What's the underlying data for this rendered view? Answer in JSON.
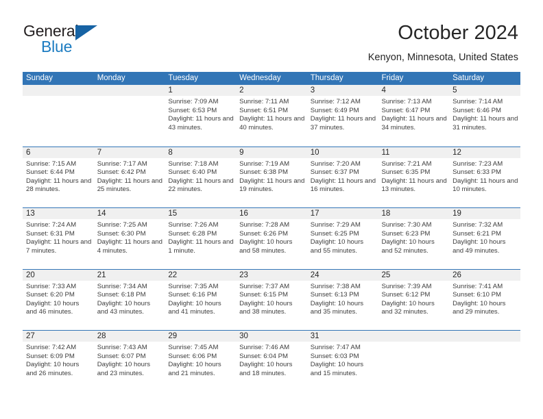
{
  "brand": {
    "word1": "General",
    "word2": "Blue",
    "triangle_color": "#1763a4",
    "word2_color": "#1c7cc1"
  },
  "header": {
    "title": "October 2024",
    "location": "Kenyon, Minnesota, United States"
  },
  "theme": {
    "header_blue": "#3275b6",
    "daynum_band": "#f0f0f0",
    "text": "#262626"
  },
  "weekdays": [
    "Sunday",
    "Monday",
    "Tuesday",
    "Wednesday",
    "Thursday",
    "Friday",
    "Saturday"
  ],
  "weeks": [
    [
      {
        "day": "",
        "sunrise": "",
        "sunset": "",
        "daylight": ""
      },
      {
        "day": "",
        "sunrise": "",
        "sunset": "",
        "daylight": ""
      },
      {
        "day": "1",
        "sunrise": "Sunrise: 7:09 AM",
        "sunset": "Sunset: 6:53 PM",
        "daylight": "Daylight: 11 hours and 43 minutes."
      },
      {
        "day": "2",
        "sunrise": "Sunrise: 7:11 AM",
        "sunset": "Sunset: 6:51 PM",
        "daylight": "Daylight: 11 hours and 40 minutes."
      },
      {
        "day": "3",
        "sunrise": "Sunrise: 7:12 AM",
        "sunset": "Sunset: 6:49 PM",
        "daylight": "Daylight: 11 hours and 37 minutes."
      },
      {
        "day": "4",
        "sunrise": "Sunrise: 7:13 AM",
        "sunset": "Sunset: 6:47 PM",
        "daylight": "Daylight: 11 hours and 34 minutes."
      },
      {
        "day": "5",
        "sunrise": "Sunrise: 7:14 AM",
        "sunset": "Sunset: 6:46 PM",
        "daylight": "Daylight: 11 hours and 31 minutes."
      }
    ],
    [
      {
        "day": "6",
        "sunrise": "Sunrise: 7:15 AM",
        "sunset": "Sunset: 6:44 PM",
        "daylight": "Daylight: 11 hours and 28 minutes."
      },
      {
        "day": "7",
        "sunrise": "Sunrise: 7:17 AM",
        "sunset": "Sunset: 6:42 PM",
        "daylight": "Daylight: 11 hours and 25 minutes."
      },
      {
        "day": "8",
        "sunrise": "Sunrise: 7:18 AM",
        "sunset": "Sunset: 6:40 PM",
        "daylight": "Daylight: 11 hours and 22 minutes."
      },
      {
        "day": "9",
        "sunrise": "Sunrise: 7:19 AM",
        "sunset": "Sunset: 6:38 PM",
        "daylight": "Daylight: 11 hours and 19 minutes."
      },
      {
        "day": "10",
        "sunrise": "Sunrise: 7:20 AM",
        "sunset": "Sunset: 6:37 PM",
        "daylight": "Daylight: 11 hours and 16 minutes."
      },
      {
        "day": "11",
        "sunrise": "Sunrise: 7:21 AM",
        "sunset": "Sunset: 6:35 PM",
        "daylight": "Daylight: 11 hours and 13 minutes."
      },
      {
        "day": "12",
        "sunrise": "Sunrise: 7:23 AM",
        "sunset": "Sunset: 6:33 PM",
        "daylight": "Daylight: 11 hours and 10 minutes."
      }
    ],
    [
      {
        "day": "13",
        "sunrise": "Sunrise: 7:24 AM",
        "sunset": "Sunset: 6:31 PM",
        "daylight": "Daylight: 11 hours and 7 minutes."
      },
      {
        "day": "14",
        "sunrise": "Sunrise: 7:25 AM",
        "sunset": "Sunset: 6:30 PM",
        "daylight": "Daylight: 11 hours and 4 minutes."
      },
      {
        "day": "15",
        "sunrise": "Sunrise: 7:26 AM",
        "sunset": "Sunset: 6:28 PM",
        "daylight": "Daylight: 11 hours and 1 minute."
      },
      {
        "day": "16",
        "sunrise": "Sunrise: 7:28 AM",
        "sunset": "Sunset: 6:26 PM",
        "daylight": "Daylight: 10 hours and 58 minutes."
      },
      {
        "day": "17",
        "sunrise": "Sunrise: 7:29 AM",
        "sunset": "Sunset: 6:25 PM",
        "daylight": "Daylight: 10 hours and 55 minutes."
      },
      {
        "day": "18",
        "sunrise": "Sunrise: 7:30 AM",
        "sunset": "Sunset: 6:23 PM",
        "daylight": "Daylight: 10 hours and 52 minutes."
      },
      {
        "day": "19",
        "sunrise": "Sunrise: 7:32 AM",
        "sunset": "Sunset: 6:21 PM",
        "daylight": "Daylight: 10 hours and 49 minutes."
      }
    ],
    [
      {
        "day": "20",
        "sunrise": "Sunrise: 7:33 AM",
        "sunset": "Sunset: 6:20 PM",
        "daylight": "Daylight: 10 hours and 46 minutes."
      },
      {
        "day": "21",
        "sunrise": "Sunrise: 7:34 AM",
        "sunset": "Sunset: 6:18 PM",
        "daylight": "Daylight: 10 hours and 43 minutes."
      },
      {
        "day": "22",
        "sunrise": "Sunrise: 7:35 AM",
        "sunset": "Sunset: 6:16 PM",
        "daylight": "Daylight: 10 hours and 41 minutes."
      },
      {
        "day": "23",
        "sunrise": "Sunrise: 7:37 AM",
        "sunset": "Sunset: 6:15 PM",
        "daylight": "Daylight: 10 hours and 38 minutes."
      },
      {
        "day": "24",
        "sunrise": "Sunrise: 7:38 AM",
        "sunset": "Sunset: 6:13 PM",
        "daylight": "Daylight: 10 hours and 35 minutes."
      },
      {
        "day": "25",
        "sunrise": "Sunrise: 7:39 AM",
        "sunset": "Sunset: 6:12 PM",
        "daylight": "Daylight: 10 hours and 32 minutes."
      },
      {
        "day": "26",
        "sunrise": "Sunrise: 7:41 AM",
        "sunset": "Sunset: 6:10 PM",
        "daylight": "Daylight: 10 hours and 29 minutes."
      }
    ],
    [
      {
        "day": "27",
        "sunrise": "Sunrise: 7:42 AM",
        "sunset": "Sunset: 6:09 PM",
        "daylight": "Daylight: 10 hours and 26 minutes."
      },
      {
        "day": "28",
        "sunrise": "Sunrise: 7:43 AM",
        "sunset": "Sunset: 6:07 PM",
        "daylight": "Daylight: 10 hours and 23 minutes."
      },
      {
        "day": "29",
        "sunrise": "Sunrise: 7:45 AM",
        "sunset": "Sunset: 6:06 PM",
        "daylight": "Daylight: 10 hours and 21 minutes."
      },
      {
        "day": "30",
        "sunrise": "Sunrise: 7:46 AM",
        "sunset": "Sunset: 6:04 PM",
        "daylight": "Daylight: 10 hours and 18 minutes."
      },
      {
        "day": "31",
        "sunrise": "Sunrise: 7:47 AM",
        "sunset": "Sunset: 6:03 PM",
        "daylight": "Daylight: 10 hours and 15 minutes."
      },
      {
        "day": "",
        "sunrise": "",
        "sunset": "",
        "daylight": ""
      },
      {
        "day": "",
        "sunrise": "",
        "sunset": "",
        "daylight": ""
      }
    ]
  ]
}
